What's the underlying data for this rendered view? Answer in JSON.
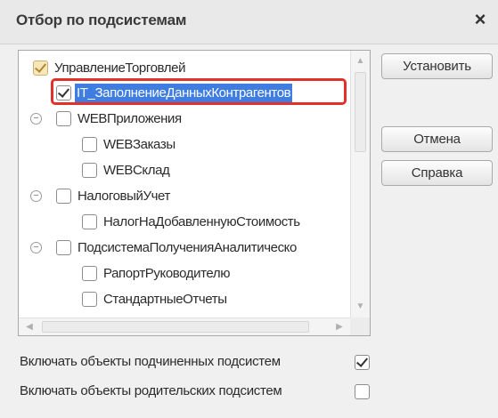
{
  "window": {
    "title": "Отбор по подсистемам",
    "close_glyph": "×"
  },
  "tree": {
    "items": [
      {
        "label": "УправлениеТорговлей",
        "state": "partial",
        "level": 0,
        "expander": ""
      },
      {
        "label": "IT_ЗаполнениеДанныхКонтрагентов",
        "state": "checked",
        "level": 1,
        "expander": "",
        "selected": true
      },
      {
        "label": "WEBПриложения",
        "state": "unchecked",
        "level": 0,
        "expander": "⊖"
      },
      {
        "label": "WEBЗаказы",
        "state": "unchecked",
        "level": 1,
        "expander": ""
      },
      {
        "label": "WEBСклад",
        "state": "unchecked",
        "level": 1,
        "expander": ""
      },
      {
        "label": "НалоговыйУчет",
        "state": "unchecked",
        "level": 0,
        "expander": "⊖"
      },
      {
        "label": "НалогНаДобавленнуюСтоимость",
        "state": "unchecked",
        "level": 1,
        "expander": ""
      },
      {
        "label": "ПодсистемаПолученияАналитическо",
        "state": "unchecked",
        "level": 0,
        "expander": "⊖"
      },
      {
        "label": "РапортРуководителю",
        "state": "unchecked",
        "level": 1,
        "expander": ""
      },
      {
        "label": "СтандартныеОтчеты",
        "state": "unchecked",
        "level": 1,
        "expander": ""
      }
    ]
  },
  "buttons": {
    "set_label": "Установить",
    "cancel_label": "Отмена",
    "help_label": "Справка"
  },
  "options": {
    "include_sub_label": "Включать объекты подчиненных подсистем",
    "include_sub_checked": true,
    "include_parent_label": "Включать объекты родительских подсистем",
    "include_parent_checked": false
  },
  "colors": {
    "selection": "#3f7de0",
    "highlight_box": "#e1312b"
  }
}
